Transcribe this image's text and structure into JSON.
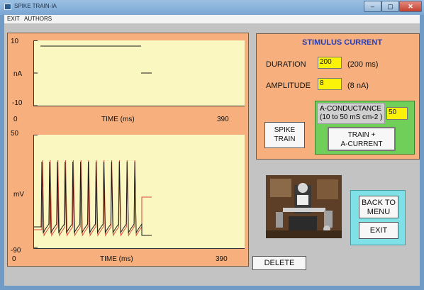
{
  "window": {
    "title": "SPIKE TRAIN-IA",
    "min": "–",
    "max": "▢",
    "close": "✕"
  },
  "menu": {
    "exit": "EXIT",
    "authors": "AUTHORS"
  },
  "top_plot": {
    "y_max": "10",
    "y_unit": "nA",
    "y_min": "-10",
    "x_min": "0",
    "x_label": "TIME (ms)",
    "x_max": "390"
  },
  "bottom_plot": {
    "y_max": "50",
    "y_unit": "mV",
    "y_min": "-90",
    "x_min": "0",
    "x_label": "TIME (ms)",
    "x_max": "390"
  },
  "stimulus": {
    "title": "STIMULUS CURRENT",
    "duration_label": "DURATION",
    "duration_value": "200",
    "duration_note": "(200 ms)",
    "amplitude_label": "AMPLITUDE",
    "amplitude_value": "8",
    "amplitude_note": "(8 nA)"
  },
  "a_conductance": {
    "line1": "A-CONDUCTANCE",
    "line2": "(10 to 50 mS cm-2 )",
    "value": "50"
  },
  "buttons": {
    "spike_train_1": "SPIKE",
    "spike_train_2": "TRAIN",
    "train_a_1": "TRAIN +",
    "train_a_2": "A-CURRENT",
    "back_1": "BACK TO",
    "back_2": "MENU",
    "exit": "EXIT",
    "delete": "DELETE"
  },
  "colors": {
    "panel": "#f7b07d",
    "plot_bg": "#fbf7c0",
    "stimulus_title": "#2a3fb0",
    "trace_black": "#1a1a1a",
    "trace_red": "#d94a3a",
    "input_yellow": "#fbf20a"
  }
}
